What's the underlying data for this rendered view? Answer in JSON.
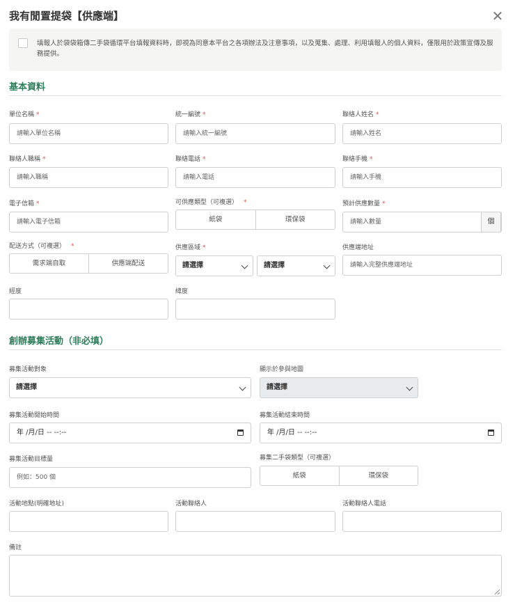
{
  "header": {
    "title": "我有閒置提袋【供應端】",
    "close_icon": "close-icon"
  },
  "consent": {
    "text": "填報人於袋袋箱傳二手袋循環平台填報資料時，即視為同意本平台之各項辦法及注意事項，以及蒐集、處理、利用填報人的個人資料，僅限用於政策宣傳及服務提供。"
  },
  "basic": {
    "section_title": "基本資料",
    "unit_name": {
      "label": "單位名稱",
      "placeholder": "請輸入單位名稱"
    },
    "tax_id": {
      "label": "統一編號",
      "placeholder": "請輸入統一編號"
    },
    "contact_name": {
      "label": "聯絡人姓名",
      "placeholder": "請輸入姓名"
    },
    "contact_title": {
      "label": "聯絡人職稱",
      "placeholder": "請輸入職稱"
    },
    "phone": {
      "label": "聯絡電話",
      "placeholder": "請輸入電話"
    },
    "mobile": {
      "label": "聯絡手機",
      "placeholder": "請輸入手機"
    },
    "email": {
      "label": "電子信箱",
      "placeholder": "請輸入電子信箱"
    },
    "bag_types": {
      "label": "可供應類型（可複選）",
      "options": [
        "紙袋",
        "環保袋"
      ]
    },
    "quantity": {
      "label": "預計供應數量",
      "placeholder": "請輸入數量",
      "unit": "個"
    },
    "delivery": {
      "label": "配送方式（可複選）",
      "options": [
        "需求端自取",
        "供應端配送"
      ]
    },
    "region": {
      "label": "供應區域",
      "city": "請選擇",
      "district": "請選擇"
    },
    "address": {
      "label": "供應端地址",
      "placeholder": "請輸入完整供應端地址"
    },
    "longitude": {
      "label": "經度",
      "value": ""
    },
    "latitude": {
      "label": "緯度",
      "value": ""
    },
    "required_mark": "*"
  },
  "activity": {
    "section_title": "創辦募集活動（非必填）",
    "target": {
      "label": "募集活動對象",
      "value": "請選擇"
    },
    "map_display": {
      "label": "顯示於參與地圖",
      "value": "請選擇"
    },
    "start_time": {
      "label": "募集活動開始時間",
      "value": "年 /月/日 -- --:--"
    },
    "end_time": {
      "label": "募集活動結束時間",
      "value": "年 /月/日 -- --:--"
    },
    "goal": {
      "label": "募集活動目標量",
      "placeholder": "例如：500 個"
    },
    "bag_types": {
      "label": "募集二手袋類型（可複選）",
      "options": [
        "紙袋",
        "環保袋"
      ]
    },
    "location": {
      "label": "活動地點(明確地址)",
      "value": ""
    },
    "contact": {
      "label": "活動聯絡人",
      "value": ""
    },
    "contact_phone": {
      "label": "活動聯絡人電話",
      "value": ""
    },
    "notes": {
      "label": "備註",
      "value": ""
    }
  }
}
